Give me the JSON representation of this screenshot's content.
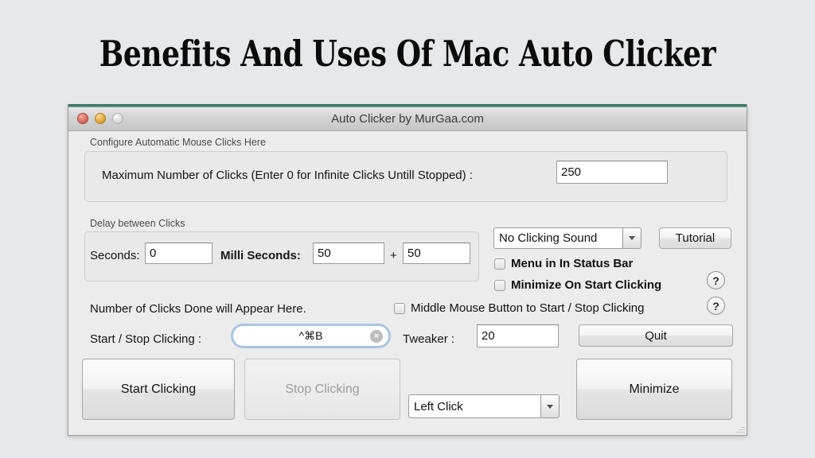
{
  "slide": {
    "title": "Benefits And Uses Of Mac Auto Clicker",
    "background_color": "#e7e8e9"
  },
  "window": {
    "title": "Auto Clicker by MurGaa.com",
    "accent_top_color": "#2e6b5e",
    "traffic_lights": [
      {
        "name": "close",
        "color": "#dd6f62"
      },
      {
        "name": "minimize",
        "color": "#e3a93c"
      },
      {
        "name": "zoom",
        "color": "#dcdcdc"
      }
    ]
  },
  "clicks_group": {
    "label": "Configure Automatic Mouse Clicks Here",
    "max_clicks_label": "Maximum Number of Clicks (Enter 0 for Infinite Clicks Untill Stopped) :",
    "max_clicks_value": "250"
  },
  "delay_group": {
    "label": "Delay between Clicks",
    "seconds_label": "Seconds:",
    "seconds_value": "0",
    "milli_label": "Milli Seconds:",
    "milli_value": "50",
    "plus_sign": "+",
    "milli_extra_value": "50"
  },
  "options": {
    "sound_dropdown_value": "No Clicking Sound",
    "tutorial_button": "Tutorial",
    "menu_status_bar_label": "Menu in In Status Bar",
    "menu_status_bar_checked": false,
    "minimize_on_start_label": "Minimize On Start Clicking",
    "minimize_on_start_checked": false,
    "help_icon_label": "?"
  },
  "status": {
    "clicks_done_text": "Number of Clicks Done will Appear Here.",
    "middle_mouse_label": "Middle Mouse Button to Start / Stop Clicking",
    "middle_mouse_checked": false
  },
  "shortcut": {
    "label": "Start / Stop Clicking :",
    "value": "^⌘B",
    "clear_icon": "×"
  },
  "tweaker": {
    "label": "Tweaker :",
    "value": "20"
  },
  "actions": {
    "quit_button": "Quit",
    "start_button": "Start Clicking",
    "stop_button": "Stop Clicking",
    "stop_button_disabled": true,
    "click_type_value": "Left Click",
    "minimize_button": "Minimize"
  }
}
